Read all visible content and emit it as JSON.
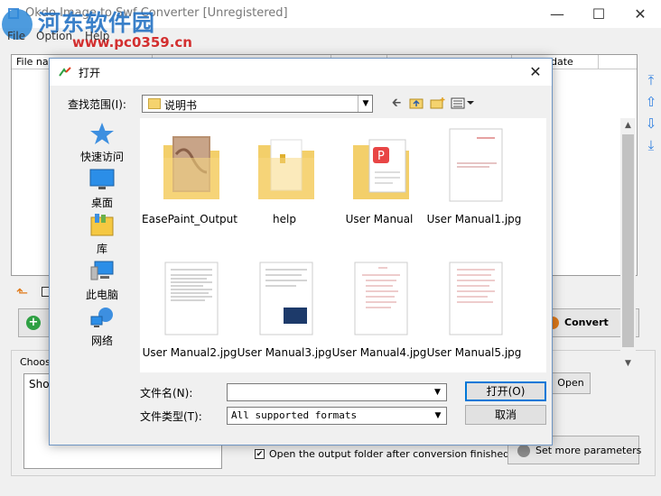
{
  "app": {
    "title": "Okdo Image to Swf Converter [Unregistered]",
    "menu": [
      "File",
      "Option",
      "Help"
    ],
    "columns": [
      "File name",
      "date"
    ],
    "choose_label": "Choos",
    "choose_box_text": "Sho",
    "open_label": "Open",
    "convert_label": "Convert",
    "open_output_checkbox_label": "Open the output folder after conversion finished",
    "open_output_checked": true,
    "set_params_label": "Set more parameters"
  },
  "watermark": {
    "brand": "河东软件园",
    "url": "www.pc0359.cn"
  },
  "dialog": {
    "title": "打开",
    "look_in_label": "查找范围(I):",
    "look_in_value": "说明书",
    "places": [
      {
        "label": "快速访问",
        "icon": "star-icon"
      },
      {
        "label": "桌面",
        "icon": "desktop-icon"
      },
      {
        "label": "库",
        "icon": "library-icon"
      },
      {
        "label": "此电脑",
        "icon": "computer-icon"
      },
      {
        "label": "网络",
        "icon": "network-icon"
      }
    ],
    "files": [
      {
        "name": "EasePaint_Output",
        "kind": "folder-image"
      },
      {
        "name": "help",
        "kind": "folder-doc"
      },
      {
        "name": "User Manual",
        "kind": "folder-pdf"
      },
      {
        "name": "User Manual1.jpg",
        "kind": "image"
      },
      {
        "name": "User Manual2.jpg",
        "kind": "image"
      },
      {
        "name": "User Manual3.jpg",
        "kind": "image"
      },
      {
        "name": "User Manual4.jpg",
        "kind": "image"
      },
      {
        "name": "User Manual5.jpg",
        "kind": "image"
      }
    ],
    "file_name_label": "文件名(N):",
    "file_name_value": "",
    "file_type_label": "文件类型(T):",
    "file_type_value": "All supported formats",
    "open_button": "打开(O)",
    "cancel_button": "取消"
  }
}
